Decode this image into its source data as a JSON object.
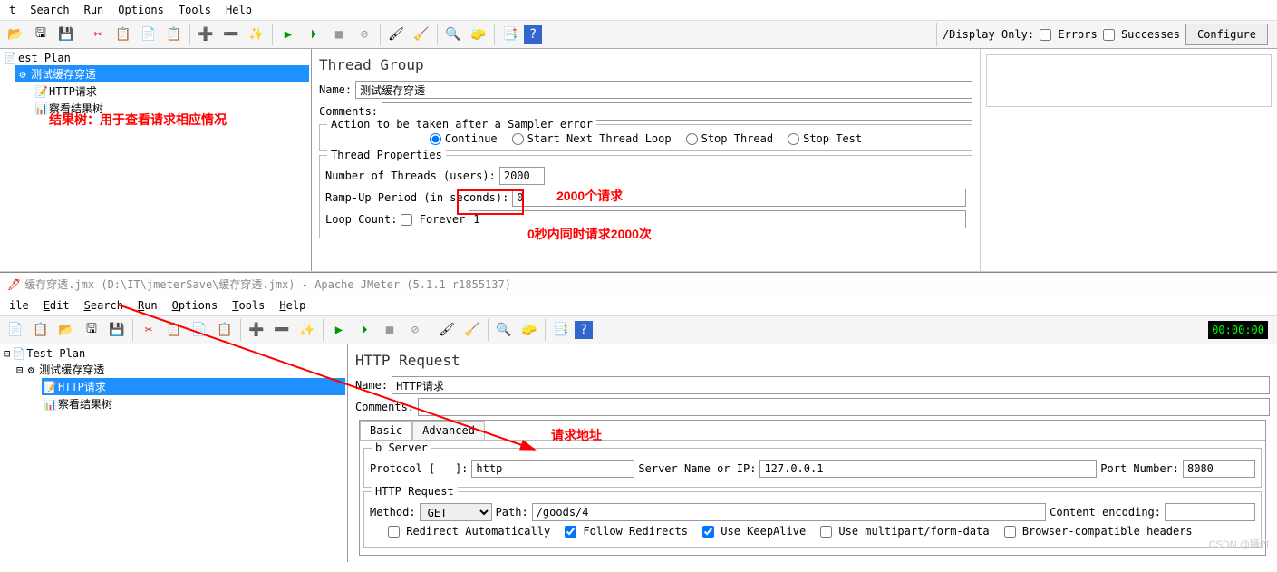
{
  "top": {
    "menu": {
      "search": "Search",
      "run": "Run",
      "options": "Options",
      "tools": "Tools",
      "help": "Help",
      "t": "t"
    },
    "tree": {
      "root": "est Plan",
      "tg": "测试缓存穿透",
      "http": "HTTP请求",
      "rt": "察看结果树"
    },
    "note": "结果树：用于查看请求相应情况",
    "tg_panel": {
      "title": "Thread Group",
      "name_lbl": "Name:",
      "name_val": "测试缓存穿透",
      "comments_lbl": "Comments:",
      "action_legend": "Action to be taken after a Sampler error",
      "radios": {
        "continue": "Continue",
        "startnext": "Start Next Thread Loop",
        "stopthread": "Stop Thread",
        "stoptest": "Stop Test"
      },
      "props_legend": "Thread Properties",
      "threads_lbl": "Number of Threads (users):",
      "threads_val": "2000",
      "ramp_lbl": "Ramp-Up Period (in seconds):",
      "ramp_val": "0",
      "loop_lbl": "Loop Count:",
      "forever_lbl": "Forever",
      "loop_val": "1",
      "note1": "2000个请求",
      "note2": "0秒内同时请求2000次"
    },
    "toolbar_right": {
      "display_only": "/Display Only:",
      "errors": "Errors",
      "successes": "Successes",
      "configure": "Configure"
    }
  },
  "bottom": {
    "title": "缓存穿透.jmx (D:\\IT\\jmeterSave\\缓存穿透.jmx) - Apache JMeter (5.1.1 r1855137)",
    "menu": {
      "ile": "ile",
      "edit": "Edit",
      "search": "Search",
      "run": "Run",
      "options": "Options",
      "tools": "Tools",
      "help": "Help"
    },
    "tree": {
      "root": "Test Plan",
      "tg": "测试缓存穿透",
      "http": "HTTP请求",
      "rt": "察看结果树"
    },
    "timer": "00:00:00",
    "http_panel": {
      "title": "HTTP Request",
      "name_lbl": "Name:",
      "name_val": "HTTP请求",
      "comments_lbl": "Comments:",
      "tab_basic": "Basic",
      "tab_adv": "Advanced",
      "webserver_legend": "b Server",
      "protocol_lbl": "Protocol [",
      "protocol_lbl2": "]:",
      "protocol_val": "http",
      "server_lbl": "Server Name or IP:",
      "server_val": "127.0.0.1",
      "port_lbl": "Port Number:",
      "port_val": "8080",
      "httpreq_legend": "HTTP Request",
      "method_lbl": "Method:",
      "method_val": "GET",
      "path_lbl": "Path:",
      "path_val": "/goods/4",
      "enc_lbl": "Content encoding:",
      "chk_redirect": "Redirect Automatically",
      "chk_follow": "Follow Redirects",
      "chk_keepalive": "Use KeepAlive",
      "chk_multipart": "Use multipart/form-data",
      "chk_browser": "Browser-compatible headers",
      "note": "请求地址"
    },
    "watermark": "CSDN @睡竹"
  }
}
